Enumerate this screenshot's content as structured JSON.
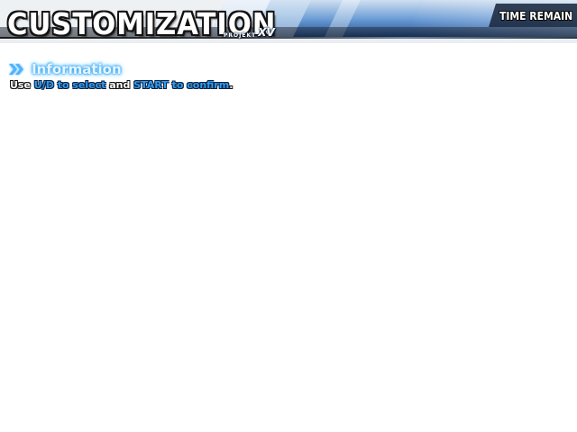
{
  "header": {
    "title": "CUSTOMIZATION",
    "brand_prefix": "PROJEKT",
    "brand_suffix": "XV",
    "timer_label": "TIME REMAIN"
  },
  "info": {
    "heading": "Information",
    "instruction": {
      "word_use": "Use",
      "key_select": "U/D to select",
      "word_and": "and",
      "key_confirm": "START to confirm",
      "end_punct": "."
    }
  },
  "colors": {
    "accent_blue": "#2e9cf2",
    "header_blue": "#3a72b8",
    "outline": "#121212"
  },
  "icons": {
    "heading_marker": "double-chevron-right-icon"
  }
}
